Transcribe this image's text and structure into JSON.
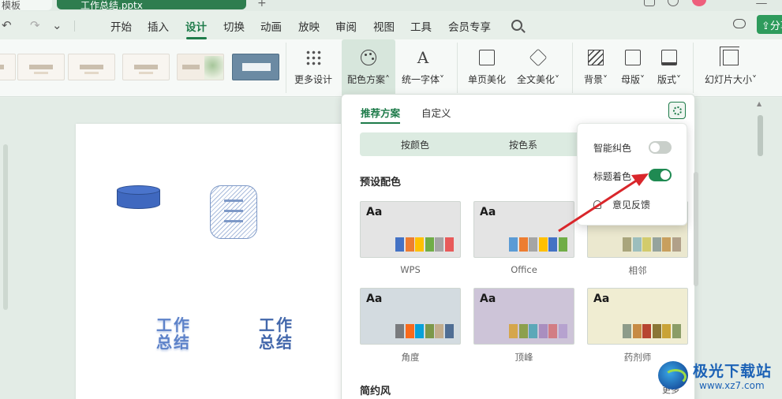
{
  "tabs": {
    "left_tab": "模板",
    "active_tab": "工作总结.pptx",
    "new_tab": "+"
  },
  "quick_access": {
    "undo": "↶",
    "redo": "↷",
    "more": "⌄"
  },
  "menu": {
    "items": [
      "开始",
      "插入",
      "设计",
      "切换",
      "动画",
      "放映",
      "审阅",
      "视图",
      "工具",
      "会员专享"
    ],
    "active_index": 2,
    "share_label": "分享"
  },
  "ribbon": {
    "more_design": "更多设计",
    "color_scheme": "配色方案",
    "unify_font": "统一字体",
    "page_beautify": "单页美化",
    "full_beautify": "全文美化",
    "background": "背景",
    "master": "母版",
    "layout": "版式",
    "slide_size": "幻灯片大小"
  },
  "slide": {
    "wordart_1": "工作\n总结",
    "wordart_2": "工作\n总结"
  },
  "panel": {
    "tab_recommended": "推荐方案",
    "tab_custom": "自定义",
    "seg_by_color": "按颜色",
    "seg_by_series": "按色系",
    "section_preset": "预设配色",
    "section_simple": "简约风",
    "more_link": "更多",
    "cards": [
      {
        "label": "WPS",
        "aa": "Aa",
        "bg": "#e4e4e4",
        "swatches": [
          "#4472c4",
          "#ed7d31",
          "#ffc000",
          "#70ad47",
          "#a5a5a5",
          "#e85a5a"
        ]
      },
      {
        "label": "Office",
        "aa": "Aa",
        "bg": "#e4e4e4",
        "swatches": [
          "#5b9bd5",
          "#ed7d31",
          "#a5a5a5",
          "#ffc000",
          "#4472c4",
          "#70ad47"
        ]
      },
      {
        "label": "相邻",
        "aa": "Aa",
        "bg": "#ebe8cf",
        "swatches": [
          "#a9a57c",
          "#9cbebd",
          "#d2cb6c",
          "#95a39d",
          "#c89f5d",
          "#b1a089"
        ]
      },
      {
        "label": "角度",
        "aa": "Aa",
        "bg": "#d3dbe0",
        "swatches": [
          "#797b7e",
          "#f96a1b",
          "#08a1d9",
          "#7c984a",
          "#c2ad8d",
          "#506e94"
        ]
      },
      {
        "label": "顶峰",
        "aa": "Aa",
        "bg": "#cdc4d8",
        "swatches": [
          "#d5a64c",
          "#8ca04d",
          "#5ca8b8",
          "#a98ebf",
          "#d27d84",
          "#b6a2cf"
        ]
      },
      {
        "label": "药剂师",
        "aa": "Aa",
        "bg": "#f0edd2",
        "swatches": [
          "#8e9c8a",
          "#c78b44",
          "#b74531",
          "#8a7636",
          "#c9a337",
          "#8b9d67"
        ]
      }
    ]
  },
  "popup": {
    "smart_correct": "智能纠色",
    "smart_correct_on": false,
    "title_color": "标题着色",
    "title_color_on": true,
    "feedback": "意见反馈"
  },
  "watermark": {
    "title": "极光下载站",
    "url": "www.xz7.com"
  },
  "colors": {
    "accent": "#1e7b4a",
    "toggle_on": "#1f8a52",
    "arrow": "#d9262b"
  }
}
